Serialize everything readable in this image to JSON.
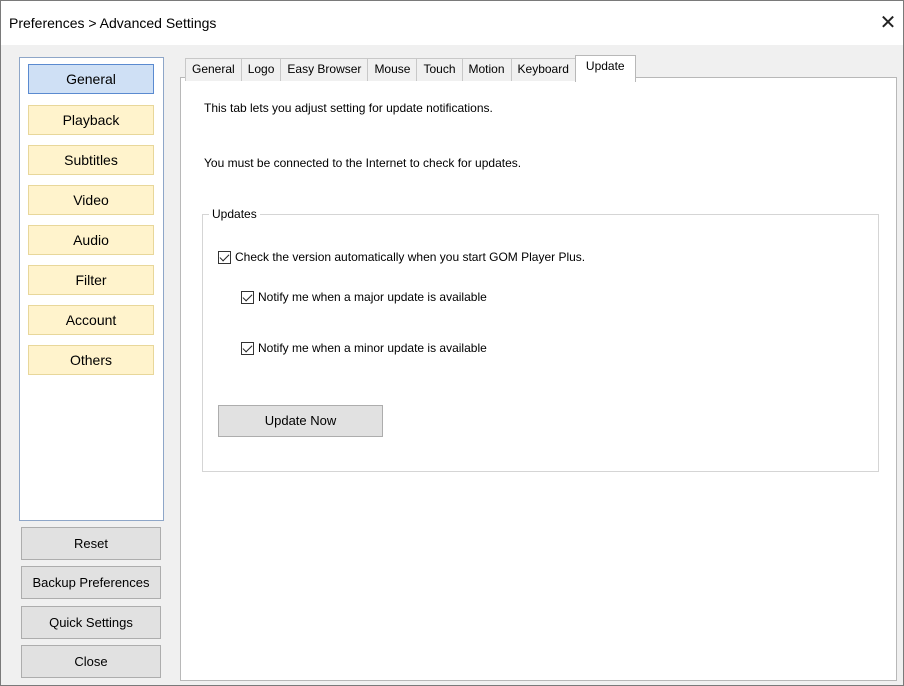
{
  "window": {
    "title": "Preferences > Advanced Settings",
    "close_label": "✕"
  },
  "sidebar": {
    "categories": [
      {
        "label": "General",
        "active": true
      },
      {
        "label": "Playback",
        "active": false
      },
      {
        "label": "Subtitles",
        "active": false
      },
      {
        "label": "Video",
        "active": false
      },
      {
        "label": "Audio",
        "active": false
      },
      {
        "label": "Filter",
        "active": false
      },
      {
        "label": "Account",
        "active": false
      },
      {
        "label": "Others",
        "active": false
      }
    ],
    "buttons": {
      "reset": "Reset",
      "backup": "Backup Preferences",
      "quick": "Quick Settings",
      "close": "Close"
    }
  },
  "tabs": [
    {
      "label": "General",
      "active": false
    },
    {
      "label": "Logo",
      "active": false
    },
    {
      "label": "Easy Browser",
      "active": false
    },
    {
      "label": "Mouse",
      "active": false
    },
    {
      "label": "Touch",
      "active": false
    },
    {
      "label": "Motion",
      "active": false
    },
    {
      "label": "Keyboard",
      "active": false
    },
    {
      "label": "Update",
      "active": true
    }
  ],
  "content": {
    "description": "This tab lets you adjust setting for update notifications.",
    "internet_note": "You must be connected to the Internet to check for updates.",
    "group_title": "Updates",
    "check_auto": {
      "label": "Check the version automatically when you start GOM Player Plus.",
      "checked": true
    },
    "notify_major": {
      "label": "Notify me when a major update is available",
      "checked": true
    },
    "notify_minor": {
      "label": "Notify me when a minor update is available",
      "checked": true
    },
    "update_now": "Update Now"
  }
}
